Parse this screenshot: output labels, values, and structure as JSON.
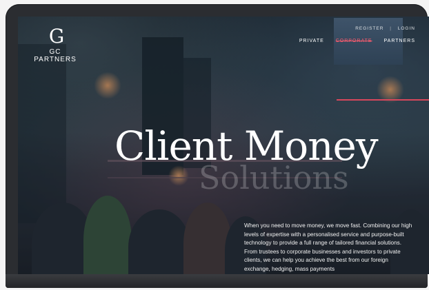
{
  "brand": {
    "mark": "G",
    "name": "GC PARTNERS"
  },
  "nav": {
    "top": [
      "REGISTER",
      "LOGIN"
    ],
    "main": [
      "PRIVATE",
      "CORPORATE",
      "PARTNERS"
    ],
    "active": "CORPORATE"
  },
  "hero": {
    "title": "Client Money",
    "subtitle": "Solutions",
    "body": "When you need to move money, we move fast. Combining our high levels of expertise with a personalised service and purpose-built technology to provide a full range of tailored financial solutions. From trustees to corporate businesses and investors to private clients, we can help you achieve the best from our foreign exchange, hedging, mass payments"
  },
  "colors": {
    "accent": "#d9475c",
    "active_nav": "#ff5b6e"
  }
}
